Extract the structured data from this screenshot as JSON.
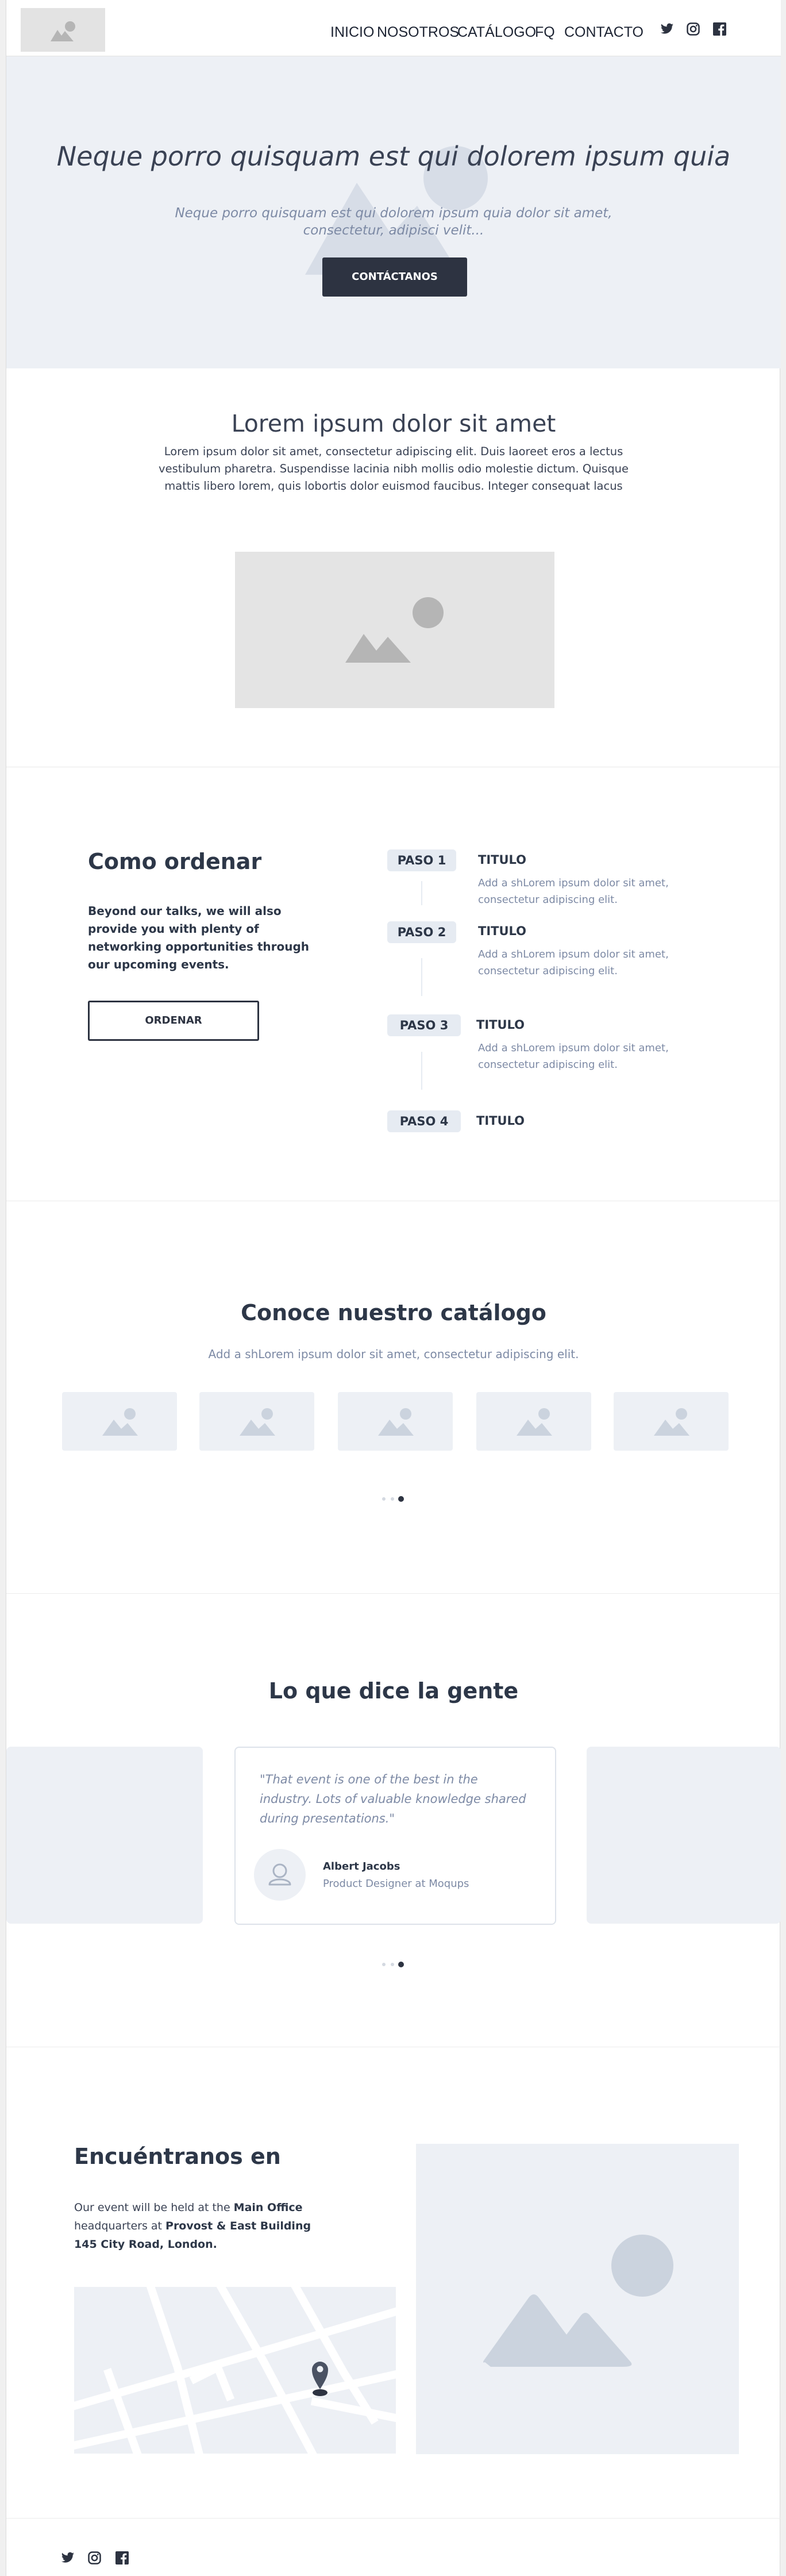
{
  "nav": {
    "links": [
      "INICIO",
      "NOSOTROS",
      "CATÁLOGO",
      "FQ",
      "CONTACTO"
    ],
    "social_icons": [
      "twitter-icon",
      "instagram-icon",
      "facebook-icon"
    ]
  },
  "hero": {
    "title": "Neque porro quisquam est qui dolorem ipsum quia",
    "subtitle": "Neque porro quisquam est qui dolorem ipsum quia dolor sit amet, consectetur, adipisci velit...",
    "cta": "CONTÁCTANOS"
  },
  "intro": {
    "heading": "Lorem ipsum dolor sit amet",
    "text": "Lorem ipsum dolor sit amet, consectetur adipiscing elit. Duis laoreet eros a lectus vestibulum pharetra. Suspendisse lacinia nibh mollis odio molestie dictum. Quisque mattis libero lorem, quis lobortis dolor euismod faucibus. Integer consequat lacus"
  },
  "steps": {
    "heading": "Como ordenar",
    "text": "Beyond our talks, we will also provide you with plenty of networking opportunities through our upcoming events.",
    "button": "ORDENAR",
    "items": [
      {
        "label": "PASO 1",
        "title": "TITULO",
        "desc": "Add a shLorem ipsum dolor sit amet, consectetur adipiscing elit."
      },
      {
        "label": "PASO 2",
        "title": "TITULO",
        "desc": "Add a shLorem ipsum dolor sit amet, consectetur adipiscing elit."
      },
      {
        "label": "PASO 3",
        "title": "TITULO",
        "desc": "Add a shLorem ipsum dolor sit amet, consectetur adipiscing elit."
      },
      {
        "label": "PASO 4",
        "title": "TITULO",
        "desc": ""
      }
    ]
  },
  "catalog": {
    "heading": "Conoce nuestro catálogo",
    "subtitle": "Add a shLorem ipsum dolor sit amet, consectetur adipiscing elit.",
    "slides": 3,
    "active_slide": 3
  },
  "testimonials": {
    "heading": "Lo que dice la gente",
    "quote": "\"That event is one of the best in the industry. Lots of valuable knowledge shared during presentations.\"",
    "author": "Albert Jacobs",
    "role": "Product Designer at Moqups",
    "slides": 3,
    "active_slide": 3
  },
  "location": {
    "heading": "Encuéntranos en",
    "text_1": "Our event will be held at the ",
    "bold_1": "Main Office",
    "text_2": " headquarters at ",
    "bold_2": "Provost & East Building 145 City Road, London."
  },
  "colors": {
    "dark": "#2d3341",
    "muted": "#7d8aa5",
    "placeholder_bg": "#edf0f5",
    "placeholder_shape": "#cbd3de"
  }
}
